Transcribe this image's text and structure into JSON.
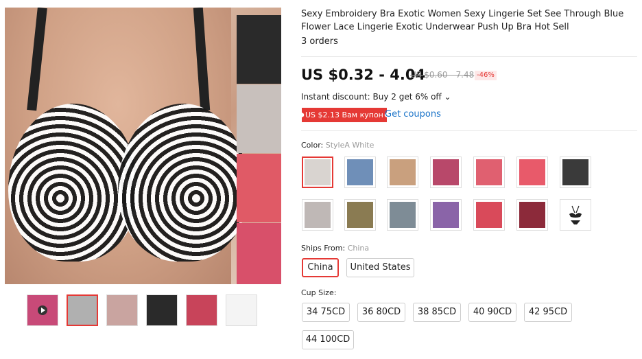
{
  "product": {
    "title": "Sexy Embroidery Bra Exotic Women Sexy Lingerie Set See Through Blue Flower Lace Lingerie Exotic Underwear Push Up Bra Hot Sell",
    "orders": "3 orders",
    "price": "US $0.32 - 4.04",
    "old_price": "US $0.60 - 7.48",
    "discount": "-46%",
    "instant_discount": "Instant discount: Buy 2 get 6% off ⌄",
    "coupon_badge": "US $2.13 Вам купон",
    "get_coupons": "Get coupons"
  },
  "color": {
    "label": "Color:",
    "selected": "StyleA White",
    "swatch_colors": [
      "#d9d4d0",
      "#6f8fb8",
      "#c9a07e",
      "#b8486a",
      "#e06070",
      "#e85a6a",
      "#3a3a3a",
      "#bfb8b6",
      "#8a7b52",
      "#7e8c96",
      "#8a64a8",
      "#d94a5a",
      "#8c2a3a",
      "#ffffff"
    ]
  },
  "ships_from": {
    "label": "Ships From:",
    "selected": "China",
    "options": [
      "China",
      "United States"
    ]
  },
  "cup_size": {
    "label": "Cup Size:",
    "options": [
      "34 75CD",
      "36 80CD",
      "38 85CD",
      "40 90CD",
      "42 95CD",
      "44 100CD"
    ]
  },
  "gallery": {
    "thumb_colors": [
      "#c84a78",
      "#b0b0b0",
      "#c9a4a0",
      "#2a2a2a",
      "#c8445a",
      "#f4f4f4"
    ],
    "side_colors": [
      "#2a2a2a",
      "#c8c0bc",
      "#e05a66",
      "#d8506a"
    ]
  },
  "colors": {
    "accent": "#e53935",
    "link": "#1a73c8"
  }
}
